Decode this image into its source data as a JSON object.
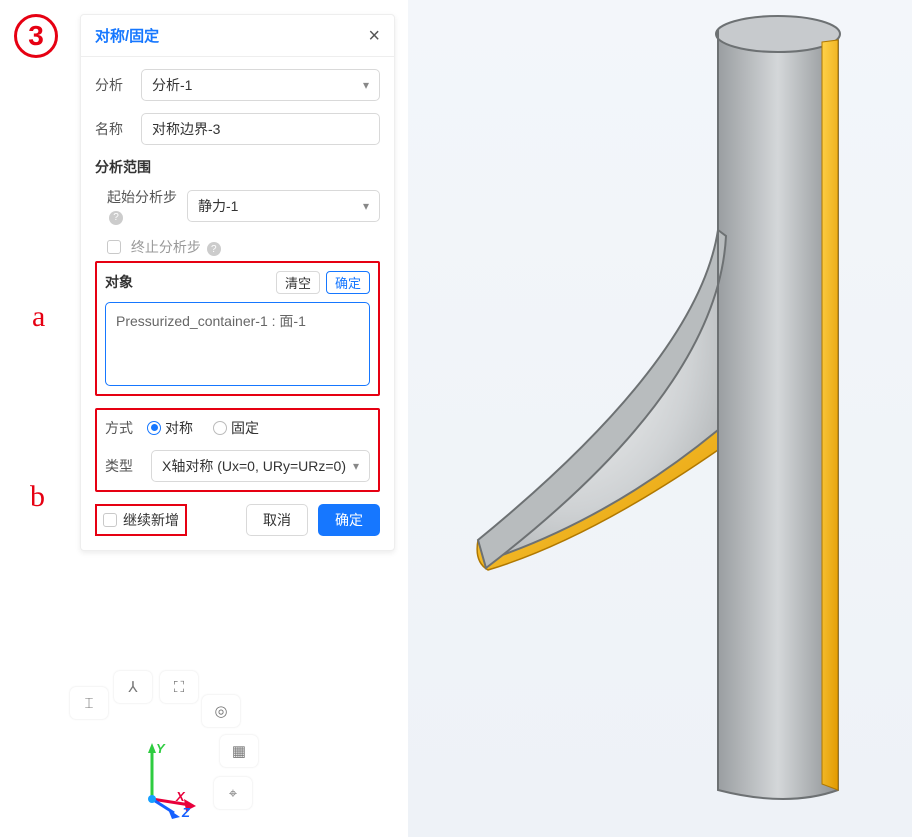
{
  "annotations": {
    "step_number": "3",
    "letter_a": "a",
    "letter_b": "b"
  },
  "panel": {
    "title": "对称/固定",
    "close_glyph": "×",
    "analysis": {
      "label": "分析",
      "value": "分析-1"
    },
    "name": {
      "label": "名称",
      "value": "对称边界-3"
    },
    "scope": {
      "title": "分析范围",
      "start_step_label": "起始分析步",
      "start_step_value": "静力-1",
      "end_step_label": "终止分析步",
      "help_glyph": "?"
    },
    "object": {
      "title": "对象",
      "clear_label": "清空",
      "confirm_label": "确定",
      "selected_item": "Pressurized_container-1 : 面-1"
    },
    "method": {
      "label": "方式",
      "option_sym": "对称",
      "option_fix": "固定"
    },
    "type": {
      "label": "类型",
      "value": "X轴对称 (Ux=0, URy=URz=0)"
    },
    "footer": {
      "keep_add_label": "继续新增",
      "cancel_label": "取消",
      "ok_label": "确定"
    }
  },
  "triad": {
    "x": "X",
    "y": "Y",
    "z": "Z"
  },
  "colors": {
    "accent": "#1677ff",
    "highlight": "#e60012",
    "model_grey": "#b6babc",
    "model_edge": "#6d7173",
    "model_yellow": "#f0b400"
  }
}
